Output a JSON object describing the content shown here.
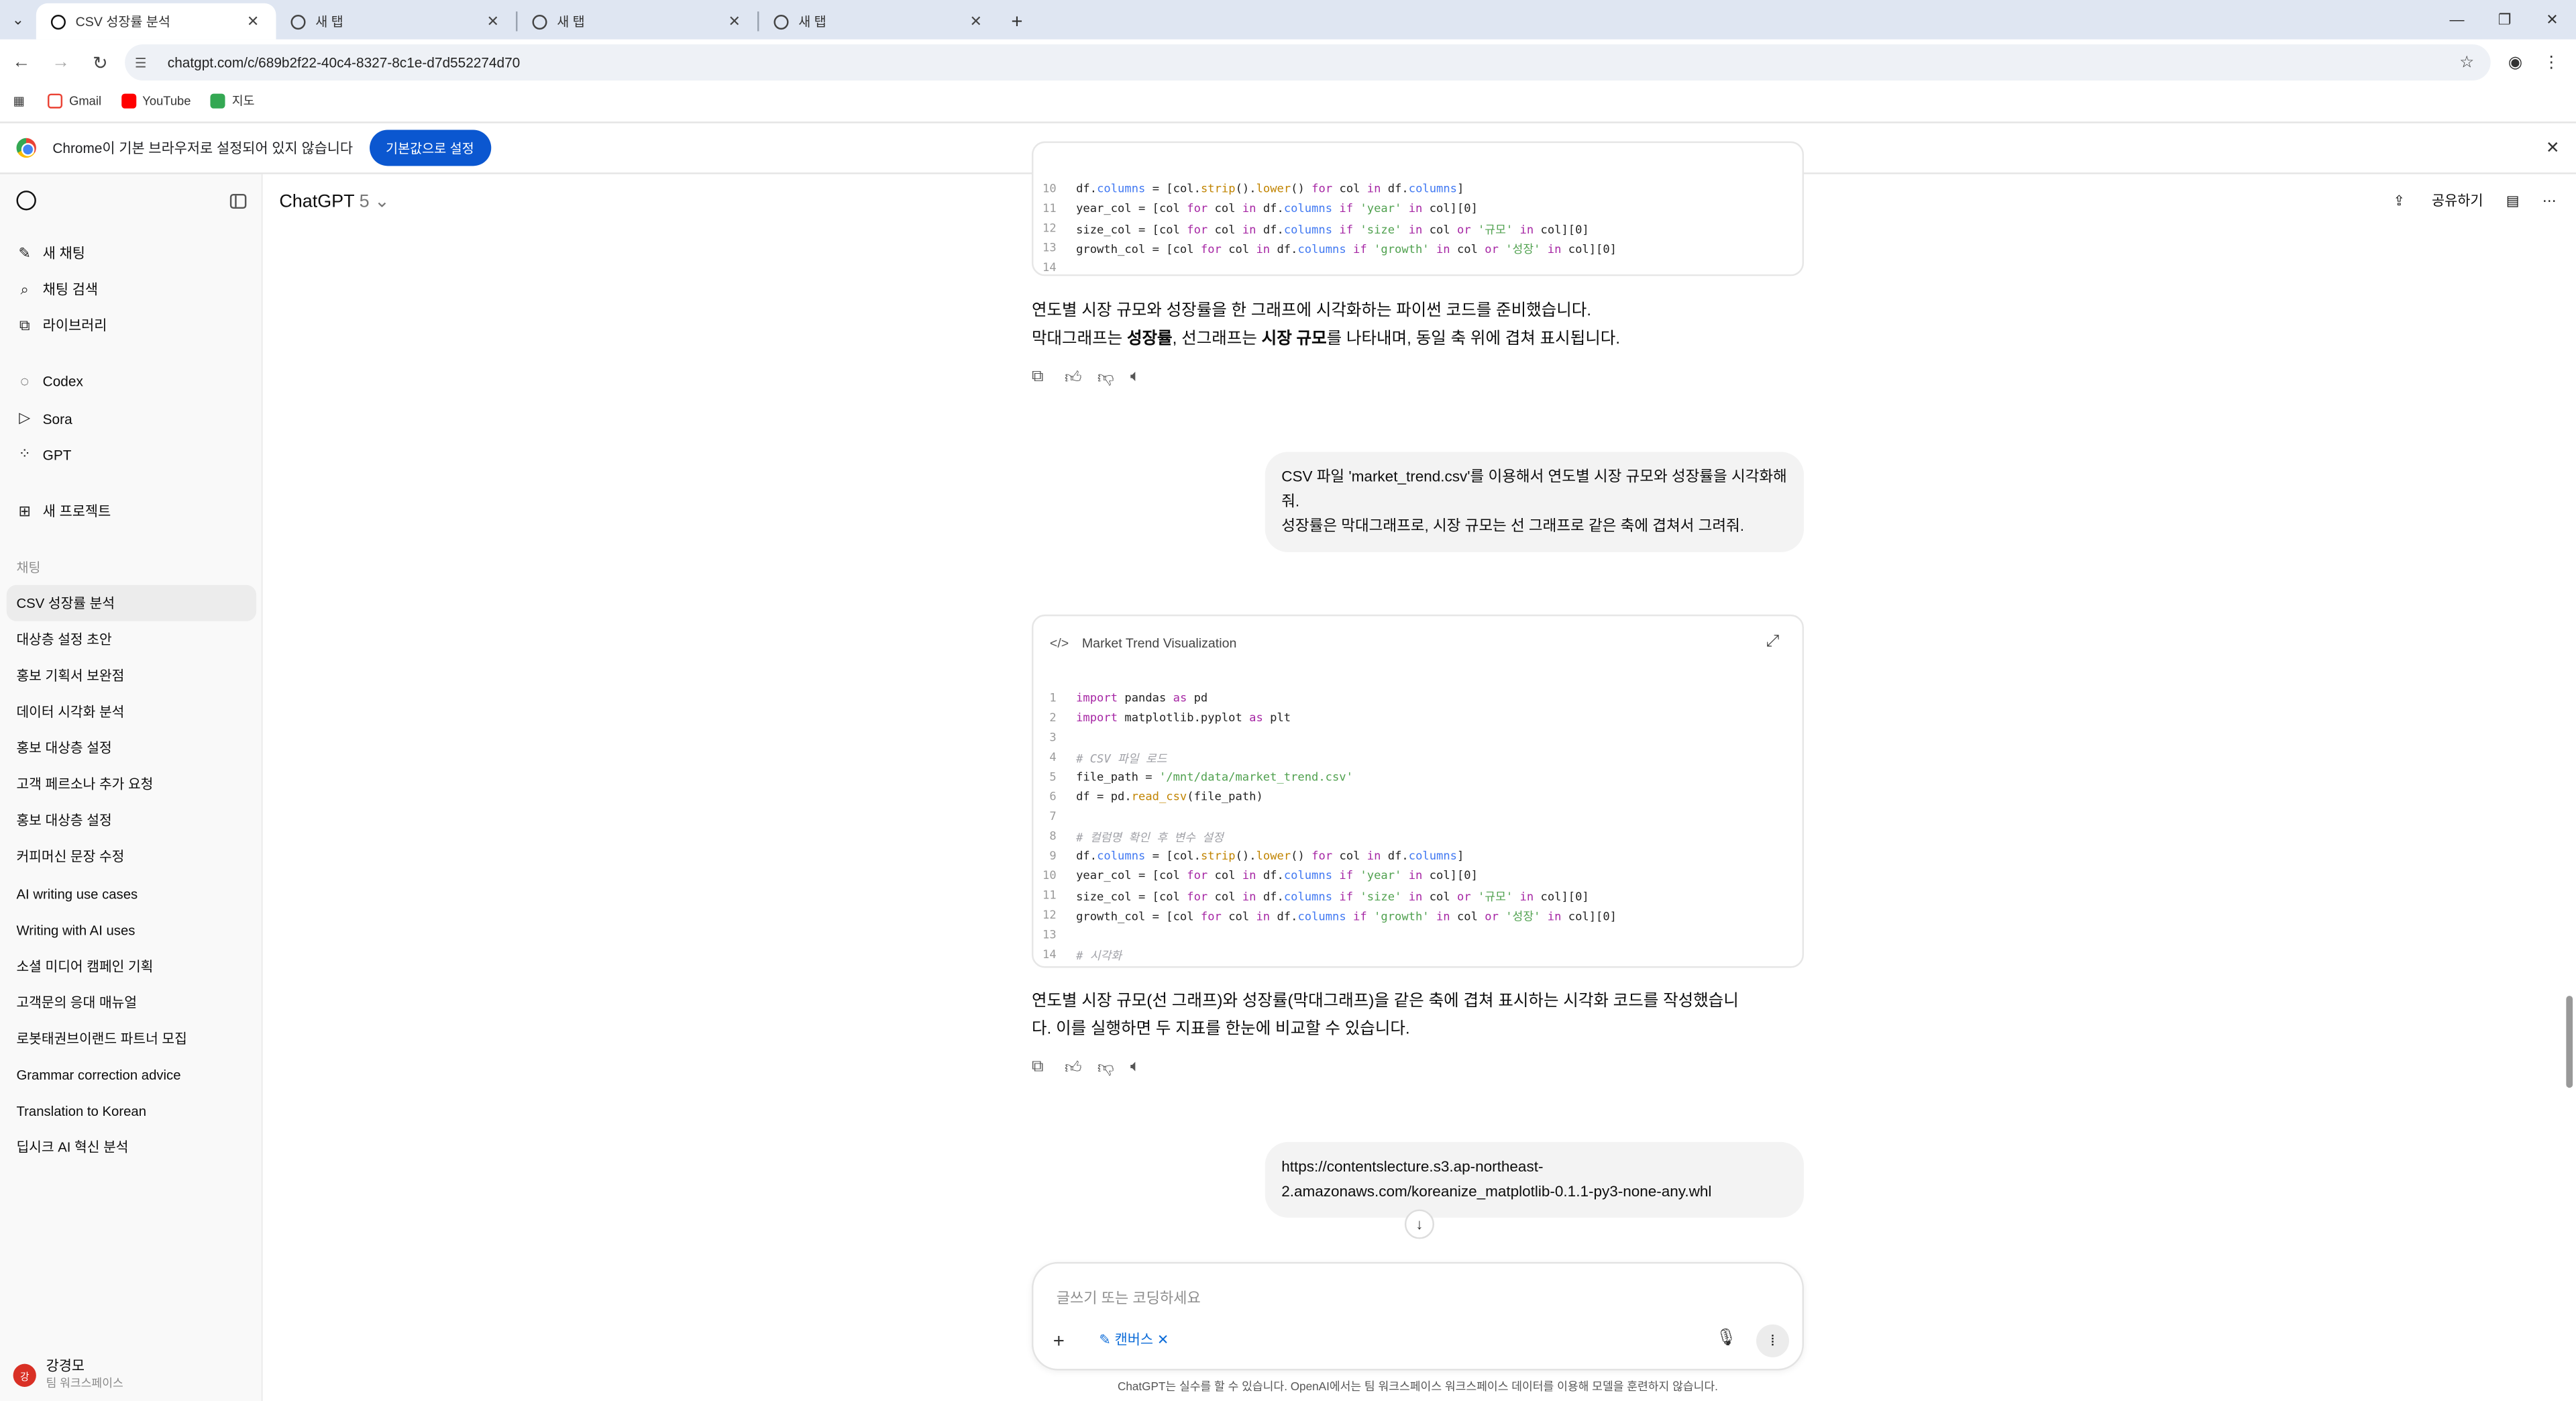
{
  "browser": {
    "tabs": [
      {
        "title": "CSV 성장률 분석",
        "active": true
      },
      {
        "title": "새 탭",
        "active": false
      },
      {
        "title": "새 탭",
        "active": false
      },
      {
        "title": "새 탭",
        "active": false
      }
    ],
    "url": "chatgpt.com/c/689b2f22-40c4-8327-8c1e-d7d552274d70",
    "bookmarks": [
      {
        "label": "Gmail",
        "color": "#ea4335"
      },
      {
        "label": "YouTube",
        "color": "#ff0000"
      },
      {
        "label": "지도",
        "color": "#34a853"
      }
    ],
    "infobar": {
      "message": "Chrome이 기본 브라우저로 설정되어 있지 않습니다",
      "button": "기본값으로 설정"
    }
  },
  "sidebar": {
    "nav": [
      {
        "label": "새 채팅",
        "icon": "compose-icon"
      },
      {
        "label": "채팅 검색",
        "icon": "search-icon"
      },
      {
        "label": "라이브러리",
        "icon": "library-icon"
      },
      {
        "label": "Codex",
        "icon": "codex-icon"
      },
      {
        "label": "Sora",
        "icon": "sora-icon"
      },
      {
        "label": "GPT",
        "icon": "gpt-grid-icon"
      },
      {
        "label": "새 프로젝트",
        "icon": "folder-plus-icon"
      }
    ],
    "chats_label": "채팅",
    "chats": [
      "CSV 성장률 분석",
      "대상층 설정 초안",
      "홍보 기획서 보완점",
      "데이터 시각화 분석",
      "홍보 대상층 설정",
      "고객 페르소나 추가 요청",
      "홍보 대상층 설정",
      "커피머신 문장 수정",
      "AI writing use cases",
      "Writing with AI uses",
      "소셜 미디어 캠페인 기획",
      "고객문의 응대 매뉴얼",
      "로봇태권브이랜드 파트너 모집",
      "Grammar correction advice",
      "Translation to Korean",
      "딥시크 AI 혁신 분석"
    ],
    "user": {
      "name": "강경모",
      "plan": "팀 워크스페이스",
      "initials": "강"
    }
  },
  "header": {
    "model": "ChatGPT",
    "version": "5",
    "share": "공유하기"
  },
  "code_top": [
    {
      "n": "10",
      "html": "df.<span class=\"var\">columns</span> = [col.<span class=\"fn\">strip</span>().<span class=\"fn\">lower</span>() <span class=\"kw\">for</span> col <span class=\"kw\">in</span> df.<span class=\"var\">columns</span>]"
    },
    {
      "n": "11",
      "html": "year_col = [col <span class=\"kw\">for</span> col <span class=\"kw\">in</span> df.<span class=\"var\">columns</span> <span class=\"kw\">if</span> <span class=\"str\">'year'</span> <span class=\"kw\">in</span> col][0]"
    },
    {
      "n": "12",
      "html": "size_col = [col <span class=\"kw\">for</span> col <span class=\"kw\">in</span> df.<span class=\"var\">columns</span> <span class=\"kw\">if</span> <span class=\"str\">'size'</span> <span class=\"kw\">in</span> col <span class=\"kw\">or</span> <span class=\"str\">'규모'</span> <span class=\"kw\">in</span> col][0]"
    },
    {
      "n": "13",
      "html": "growth_col = [col <span class=\"kw\">for</span> col <span class=\"kw\">in</span> df.<span class=\"var\">columns</span> <span class=\"kw\">if</span> <span class=\"str\">'growth'</span> <span class=\"kw\">in</span> col <span class=\"kw\">or</span> <span class=\"str\">'성장'</span> <span class=\"kw\">in</span> col][0]"
    },
    {
      "n": "14",
      "html": ""
    }
  ],
  "reply1": {
    "line1": "연도별 시장 규모와 성장률을 한 그래프에 시각화하는 파이썬 코드를 준비했습니다.",
    "line2_a": "막대그래프는 ",
    "line2_b": "성장률",
    "line2_c": ", 선그래프는 ",
    "line2_d": "시장 규모",
    "line2_e": "를 나타내며, 동일 축 위에 겹쳐 표시됩니다."
  },
  "user_msg1": {
    "line1": "CSV 파일 'market_trend.csv'를 이용해서 연도별 시장 규모와 성장률을 시각화해 줘.",
    "line2": "성장률은 막대그래프로, 시장 규모는 선 그래프로 같은 축에 겹쳐서 그려줘."
  },
  "code_card": {
    "title": "Market Trend Visualization",
    "lines": [
      {
        "n": "1",
        "html": "<span class=\"kw\">import</span> pandas <span class=\"kw\">as</span> pd"
      },
      {
        "n": "2",
        "html": "<span class=\"kw\">import</span> matplotlib.pyplot <span class=\"kw\">as</span> plt"
      },
      {
        "n": "3",
        "html": ""
      },
      {
        "n": "4",
        "html": "<span class=\"cmt\"># CSV 파일 로드</span>"
      },
      {
        "n": "5",
        "html": "file_path = <span class=\"str\">'/mnt/data/market_trend.csv'</span>"
      },
      {
        "n": "6",
        "html": "df = pd.<span class=\"fn\">read_csv</span>(file_path)"
      },
      {
        "n": "7",
        "html": ""
      },
      {
        "n": "8",
        "html": "<span class=\"cmt\"># 컬럼명 확인 후 변수 설정</span>"
      },
      {
        "n": "9",
        "html": "df.<span class=\"var\">columns</span> = [col.<span class=\"fn\">strip</span>().<span class=\"fn\">lower</span>() <span class=\"kw\">for</span> col <span class=\"kw\">in</span> df.<span class=\"var\">columns</span>]"
      },
      {
        "n": "10",
        "html": "year_col = [col <span class=\"kw\">for</span> col <span class=\"kw\">in</span> df.<span class=\"var\">columns</span> <span class=\"kw\">if</span> <span class=\"str\">'year'</span> <span class=\"kw\">in</span> col][0]"
      },
      {
        "n": "11",
        "html": "size_col = [col <span class=\"kw\">for</span> col <span class=\"kw\">in</span> df.<span class=\"var\">columns</span> <span class=\"kw\">if</span> <span class=\"str\">'size'</span> <span class=\"kw\">in</span> col <span class=\"kw\">or</span> <span class=\"str\">'규모'</span> <span class=\"kw\">in</span> col][0]"
      },
      {
        "n": "12",
        "html": "growth_col = [col <span class=\"kw\">for</span> col <span class=\"kw\">in</span> df.<span class=\"var\">columns</span> <span class=\"kw\">if</span> <span class=\"str\">'growth'</span> <span class=\"kw\">in</span> col <span class=\"kw\">or</span> <span class=\"str\">'성장'</span> <span class=\"kw\">in</span> col][0]"
      },
      {
        "n": "13",
        "html": ""
      },
      {
        "n": "14",
        "html": "<span class=\"cmt\"># 시각화</span>"
      }
    ]
  },
  "reply2": {
    "line1": "연도별 시장 규모(선 그래프)와 성장률(막대그래프)을 같은 축에 겹쳐 표시하는 시각화 코드를 작성했습니",
    "line2": "다. 이를 실행하면 두 지표를 한눈에 비교할 수 있습니다."
  },
  "user_msg2": {
    "line1": "https://contentslecture.s3.ap-northeast-",
    "line2": "2.amazonaws.com/koreanize_matplotlib-0.1.1-py3-none-any.whl"
  },
  "composer": {
    "placeholder": "글쓰기 또는 코딩하세요",
    "canvas_label": "캔버스"
  },
  "disclaimer": "ChatGPT는 실수를 할 수 있습니다. OpenAI에서는 팀 워크스페이스 워크스페이스 데이터를 이용해 모델을 훈련하지 않습니다."
}
